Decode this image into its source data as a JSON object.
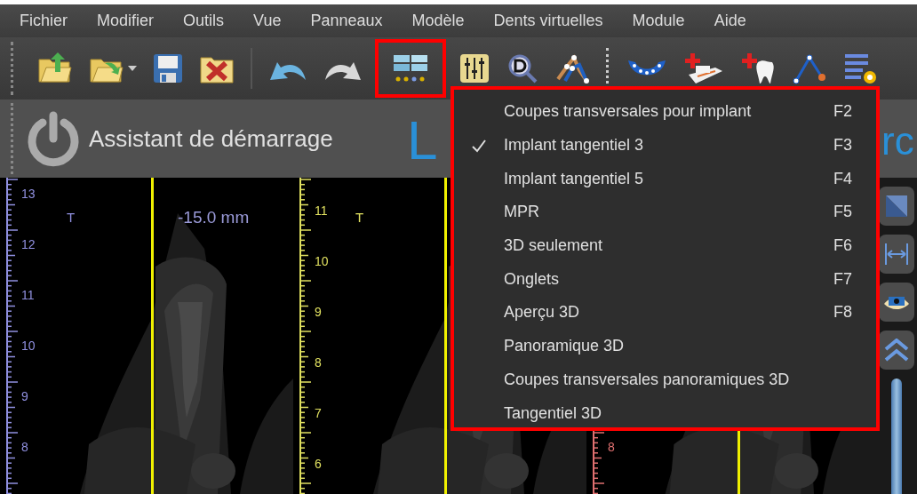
{
  "menu_bar": [
    "Fichier",
    "Modifier",
    "Outils",
    "Vue",
    "Panneaux",
    "Modèle",
    "Dents virtuelles",
    "Module",
    "Aide"
  ],
  "toolbar": {
    "layout_button": {
      "highlighted": true
    }
  },
  "wizard_bar": {
    "label": "Assistant de démarrage",
    "title_fragments": [
      "L",
      "rc"
    ]
  },
  "viewer": {
    "panels": [
      {
        "color": "#9090e0",
        "ruler_labels": [
          "13",
          "12",
          "11",
          "10",
          "9",
          "8"
        ],
        "marker": "T",
        "measurement": "-15.0 mm"
      },
      {
        "color": "#e0e060",
        "ruler_labels": [
          "11",
          "10",
          "9",
          "8",
          "7",
          "6"
        ],
        "marker": "T"
      },
      {
        "color": "#e07070",
        "ruler_labels": [
          "8"
        ]
      }
    ]
  },
  "dropdown_menu": {
    "highlighted": true,
    "items": [
      {
        "label": "Coupes transversales pour implant",
        "shortcut": "F2",
        "checked": false
      },
      {
        "label": "Implant tangentiel 3",
        "shortcut": "F3",
        "checked": true
      },
      {
        "label": "Implant tangentiel 5",
        "shortcut": "F4",
        "checked": false
      },
      {
        "label": "MPR",
        "shortcut": "F5",
        "checked": false
      },
      {
        "label": "3D seulement",
        "shortcut": "F6",
        "checked": false
      },
      {
        "label": "Onglets",
        "shortcut": "F7",
        "checked": false
      },
      {
        "label": "Aperçu 3D",
        "shortcut": "F8",
        "checked": false
      },
      {
        "label": "Panoramique 3D",
        "checked": false
      },
      {
        "label": "Coupes transversales panoramiques 3D",
        "checked": false
      },
      {
        "label": "Tangentiel 3D",
        "checked": false
      }
    ]
  }
}
